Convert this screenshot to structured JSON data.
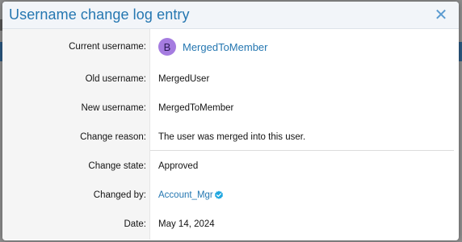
{
  "dialog": {
    "title": "Username change log entry",
    "close_symbol": "✕"
  },
  "fields": {
    "current_username": {
      "label": "Current username:",
      "value": "MergedToMember",
      "avatar_letter": "B",
      "avatar_color": "#a57ce0"
    },
    "old_username": {
      "label": "Old username:",
      "value": "MergedUser"
    },
    "new_username": {
      "label": "New username:",
      "value": "MergedToMember"
    },
    "change_reason": {
      "label": "Change reason:",
      "value": "The user was merged into this user."
    },
    "change_state": {
      "label": "Change state:",
      "value": "Approved"
    },
    "changed_by": {
      "label": "Changed by:",
      "value": "Account_Mgr",
      "badge_icon": "verified-badge-icon"
    },
    "date": {
      "label": "Date:",
      "value": "May 14, 2024"
    }
  },
  "colors": {
    "accent": "#2577b1",
    "verified": "#1fa7e0"
  }
}
